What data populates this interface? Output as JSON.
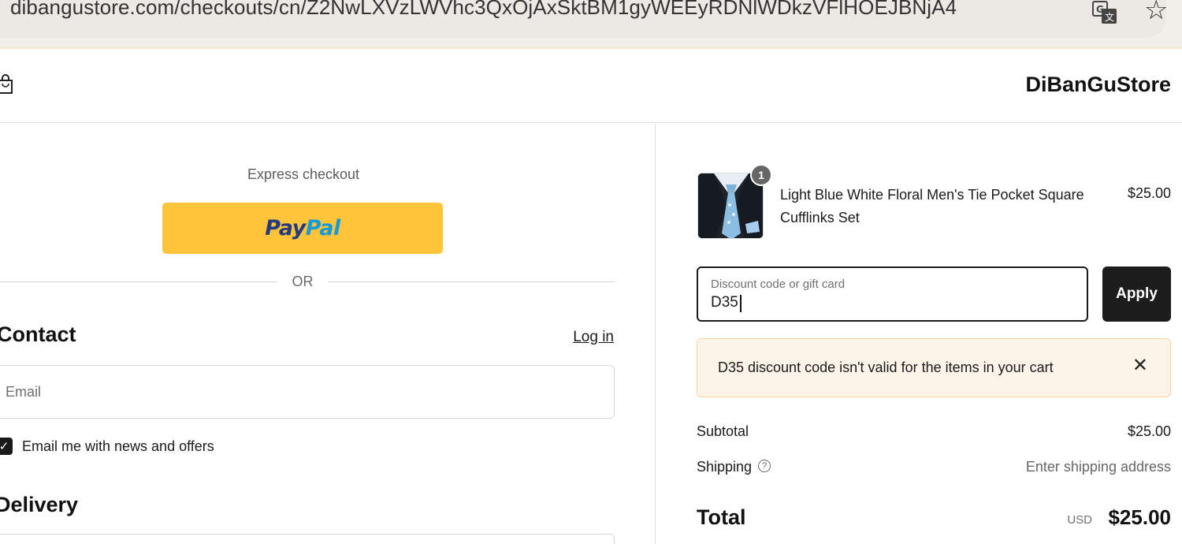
{
  "browser": {
    "url": "dibangustore.com/checkouts/cn/Z2NwLXVzLWVhc3QxOjAxSktBM1gyWEEyRDNlWDkzVFlHOEJBNjA4"
  },
  "header": {
    "store_name": "DiBanGuStore"
  },
  "express": {
    "label": "Express checkout",
    "paypal_part1": "Pay",
    "paypal_part2": "Pal",
    "or_text": "OR"
  },
  "contact": {
    "heading": "Contact",
    "login_label": "Log in",
    "email_placeholder": "Email",
    "newsletter_label": "Email me with news and offers",
    "newsletter_checked": true
  },
  "delivery": {
    "heading": "Delivery"
  },
  "cart": {
    "item": {
      "name": "Light Blue White Floral Men's Tie Pocket Square Cufflinks Set",
      "price": "$25.00",
      "quantity": "1"
    },
    "discount": {
      "label": "Discount code or gift card",
      "value": "D35",
      "apply_label": "Apply"
    },
    "error": {
      "message": "D35 discount code isn't valid for the items in your cart",
      "close_glyph": "✕"
    },
    "subtotal": {
      "label": "Subtotal",
      "value": "$25.00"
    },
    "shipping": {
      "label": "Shipping",
      "value": "Enter shipping address",
      "help_glyph": "?"
    },
    "total": {
      "label": "Total",
      "currency": "USD",
      "value": "$25.00"
    }
  },
  "colors": {
    "paypal_yellow": "#ffc439",
    "paypal_dark_blue": "#253b80",
    "paypal_light_blue": "#179bd7",
    "button_dark": "#1c1c1c",
    "error_bg": "#fdf4e9",
    "error_border": "#f6d4a6"
  }
}
